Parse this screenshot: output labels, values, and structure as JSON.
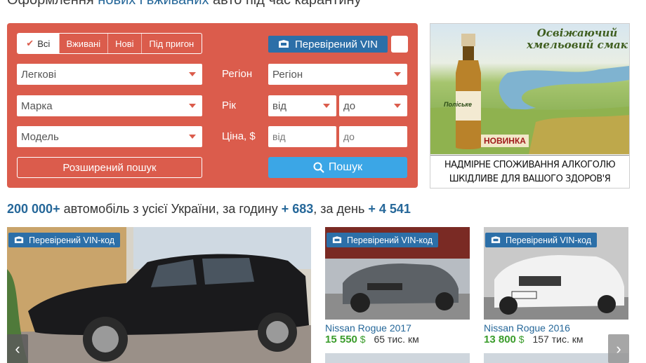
{
  "header": {
    "title_pre": "Оформлення ",
    "title_link": "нових і вживаних",
    "title_post": " авто під час карантину"
  },
  "search": {
    "tabs": [
      "Всі",
      "Вживані",
      "Нові",
      "Під пригон"
    ],
    "active_tab": "Всі",
    "vin_button": "Перевірений VIN",
    "category": "Легкові",
    "brand": "Марка",
    "model": "Модель",
    "region_label": "Регіон",
    "region": "Регіон",
    "year_label": "Рік",
    "year_from": "від",
    "year_to": "до",
    "price_label": "Ціна, $",
    "price_from_placeholder": "від",
    "price_to_placeholder": "до",
    "advanced": "Розширений пошук",
    "submit": "Пошук"
  },
  "ad": {
    "slogan": "Освіжаючий хмельовий смак",
    "badge": "НОВИНКА",
    "bottle_label": "Поліське",
    "warning_line1": "НАДМІРНЕ СПОЖИВАННЯ АЛКОГОЛЮ",
    "warning_line2": "ШКІДЛИВЕ ДЛЯ ВАШОГО ЗДОРОВ'Я"
  },
  "stats": {
    "total": "200 000+",
    "text1": " автомобіль з усієї України, за годину ",
    "per_hour": "+ 683",
    "text2": ", за день ",
    "per_day": "+ 4 541"
  },
  "listings": {
    "vin_tag": "Перевірений VIN-код",
    "items": [
      {
        "title": "Nissan Rogue 2017",
        "price": "15 550",
        "currency": "$",
        "mileage": "65 тис. км"
      },
      {
        "title": "Nissan Rogue 2016",
        "price": "13 800",
        "currency": "$",
        "mileage": "157 тис. км"
      }
    ],
    "prev": "‹",
    "next": "›"
  },
  "colors": {
    "panel": "#db5c4c",
    "link": "#256799",
    "vin": "#2c6fa8",
    "search_button": "#3ba6e6",
    "price": "#3a9c2b"
  }
}
